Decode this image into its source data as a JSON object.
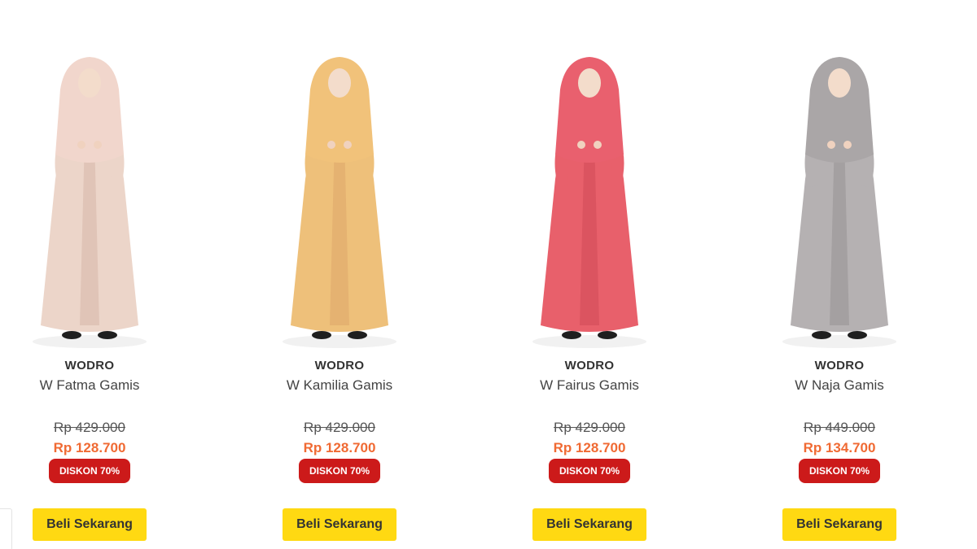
{
  "products": [
    {
      "brand": "WODRO",
      "name": "W Fatma Gamis",
      "old_price": "Rp 429.000",
      "new_price": "Rp 128.700",
      "discount": "DISKON 70%",
      "button": "Beli Sekarang",
      "dress_color": "#ecd5c9",
      "hijab_color": "#f1d6cc",
      "trim_color": "#d9b9ab"
    },
    {
      "brand": "WODRO",
      "name": "W Kamilia Gamis",
      "old_price": "Rp 429.000",
      "new_price": "Rp 128.700",
      "discount": "DISKON 70%",
      "button": "Beli Sekarang",
      "dress_color": "#eec07a",
      "hijab_color": "#f1c27a",
      "trim_color": "#e0a86a"
    },
    {
      "brand": "WODRO",
      "name": "W Fairus Gamis",
      "old_price": "Rp 429.000",
      "new_price": "Rp 128.700",
      "discount": "DISKON 70%",
      "button": "Beli Sekarang",
      "dress_color": "#e8606b",
      "hijab_color": "#e9606e",
      "trim_color": "#d24c58"
    },
    {
      "brand": "WODRO",
      "name": "W Naja Gamis",
      "old_price": "Rp 449.000",
      "new_price": "Rp 134.700",
      "discount": "DISKON 70%",
      "button": "Beli Sekarang",
      "dress_color": "#b5b1b2",
      "hijab_color": "#aaa6a7",
      "trim_color": "#9a9596"
    }
  ],
  "colors": {
    "price_orange": "#f06a33",
    "badge_red": "#cc1a1a",
    "button_yellow": "#ffd912"
  }
}
